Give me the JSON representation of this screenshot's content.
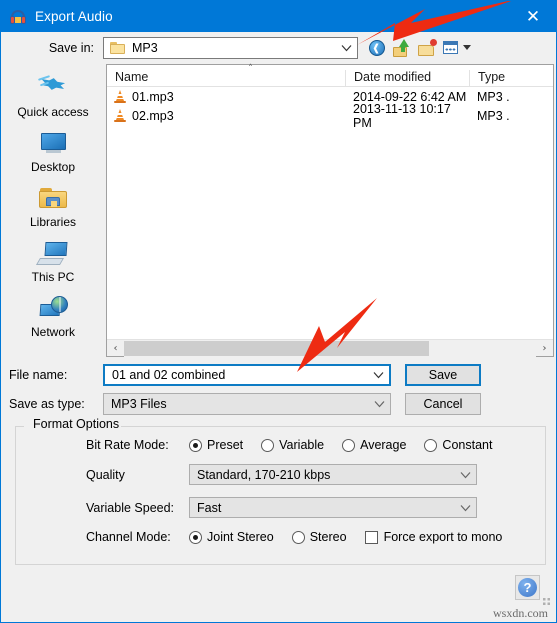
{
  "window": {
    "title": "Export Audio",
    "app_icon": "audacity-headphones-icon",
    "close_label": "✕",
    "accent_color": "#0078d7"
  },
  "savein": {
    "label": "Save in:",
    "value": "MP3",
    "folder_icon": "folder-icon",
    "dropdown_icon": "chevron-down-icon",
    "toolbar": [
      {
        "name": "back-button",
        "icon": "back-arrow-icon"
      },
      {
        "name": "up-one-level-button",
        "icon": "up-folder-icon"
      },
      {
        "name": "create-new-folder-button",
        "icon": "new-folder-icon"
      },
      {
        "name": "views-button",
        "icon": "views-grid-icon"
      }
    ]
  },
  "places": {
    "items": [
      {
        "label": "Quick access",
        "icon": "star-icon"
      },
      {
        "label": "Desktop",
        "icon": "monitor-icon"
      },
      {
        "label": "Libraries",
        "icon": "libraries-folder-icon"
      },
      {
        "label": "This PC",
        "icon": "computer-icon"
      },
      {
        "label": "Network",
        "icon": "network-globe-icon"
      }
    ]
  },
  "filelist": {
    "sort_indicator": "˄",
    "columns": [
      "Name",
      "Date modified",
      "Type"
    ],
    "rows": [
      {
        "name": "01.mp3",
        "date_modified": "2014-09-22 6:42 AM",
        "type": "MP3 .",
        "icon": "vlc-cone-icon"
      },
      {
        "name": "02.mp3",
        "date_modified": "2013-11-13 10:17 PM",
        "type": "MP3 .",
        "icon": "vlc-cone-icon"
      }
    ],
    "scrollbar": {
      "left_arrow": "‹",
      "right_arrow": "›"
    }
  },
  "filename": {
    "label": "File name:",
    "value": "01 and 02 combined",
    "dropdown_icon": "chevron-down-icon"
  },
  "savetype": {
    "label": "Save as type:",
    "value": "MP3 Files",
    "dropdown_icon": "chevron-down-icon"
  },
  "buttons": {
    "save": "Save",
    "cancel": "Cancel"
  },
  "format_options": {
    "legend": "Format Options",
    "bitrate": {
      "label": "Bit Rate Mode:",
      "options": [
        {
          "label": "Preset",
          "selected": true
        },
        {
          "label": "Variable",
          "selected": false
        },
        {
          "label": "Average",
          "selected": false
        },
        {
          "label": "Constant",
          "selected": false
        }
      ]
    },
    "quality": {
      "label": "Quality",
      "value": "Standard, 170-210 kbps"
    },
    "variable_speed": {
      "label": "Variable Speed:",
      "value": "Fast"
    },
    "channel": {
      "label": "Channel Mode:",
      "options": [
        {
          "label": "Joint Stereo",
          "selected": true
        },
        {
          "label": "Stereo",
          "selected": false
        }
      ],
      "force_mono": {
        "label": "Force export to mono",
        "checked": false
      }
    }
  },
  "help": {
    "label": "?",
    "icon": "question-mark-icon"
  },
  "watermark": "wsxdn.com",
  "annotations": {
    "color": "#ee2b12",
    "arrows": [
      {
        "name": "arrow-pointing-to-save-in-dropdown"
      },
      {
        "name": "arrow-pointing-to-file-name-field"
      }
    ]
  }
}
